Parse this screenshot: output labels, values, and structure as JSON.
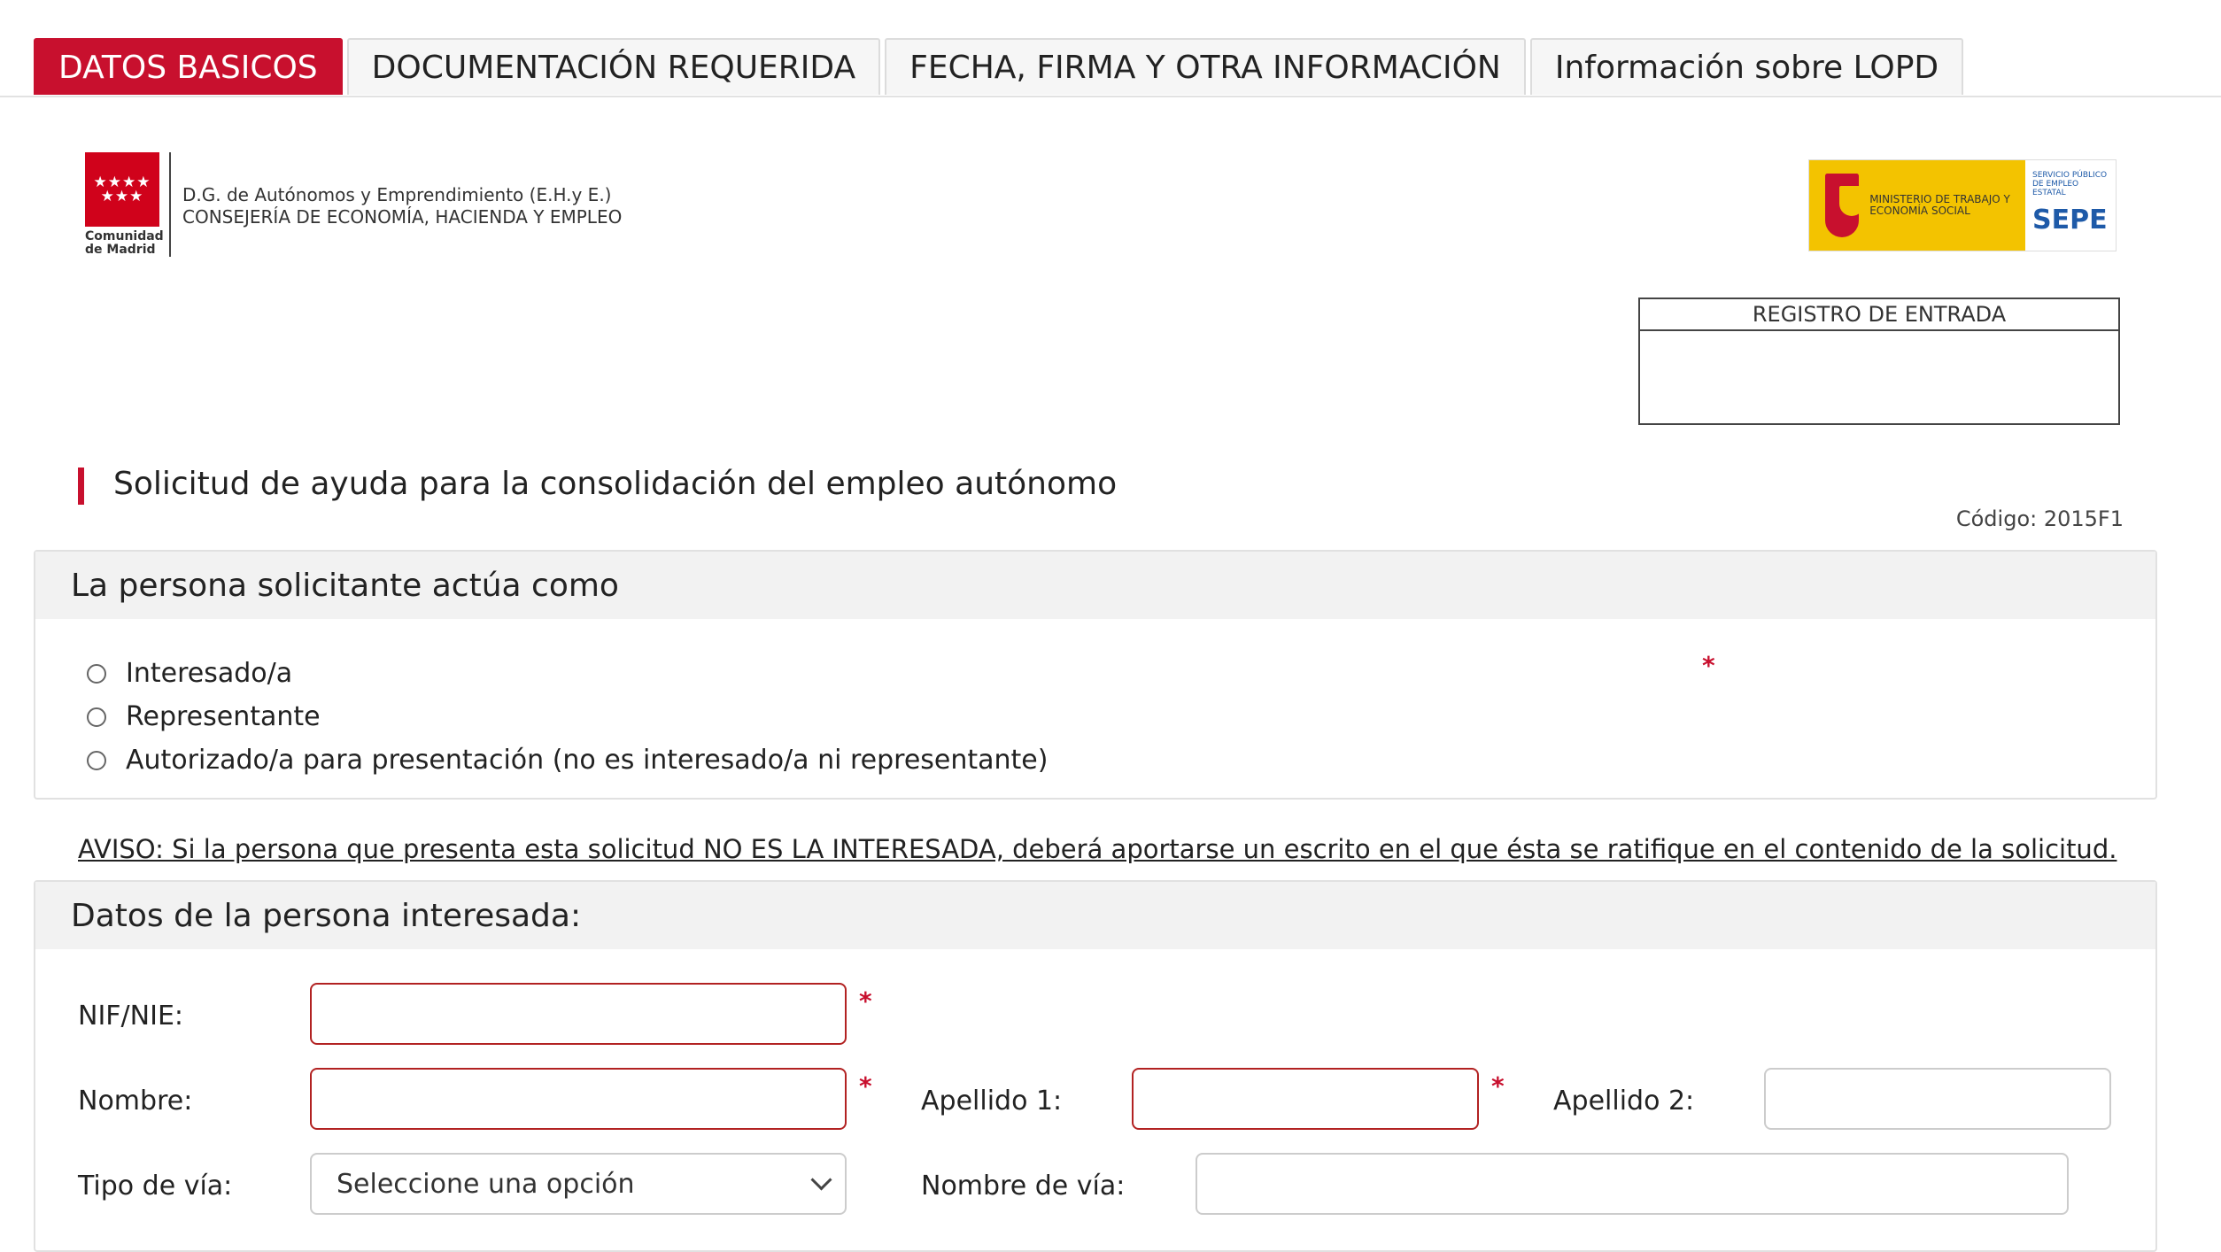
{
  "tabs": [
    {
      "label": "DATOS BASICOS",
      "active": true
    },
    {
      "label": "DOCUMENTACIÓN REQUERIDA",
      "active": false
    },
    {
      "label": "FECHA, FIRMA Y OTRA INFORMACIÓN",
      "active": false
    },
    {
      "label": "Información sobre LOPD",
      "active": false
    }
  ],
  "header": {
    "logo_text": "Comunidad de Madrid",
    "org_line1": "D.G. de Autónomos y Emprendimiento (E.H.y E.)",
    "org_line2": "CONSEJERÍA DE ECONOMÍA, HACIENDA Y EMPLEO",
    "ministry_text": "MINISTERIO DE TRABAJO Y ECONOMÍA SOCIAL",
    "sepe_small": "SERVICIO PÚBLICO DE EMPLEO ESTATAL",
    "sepe_brand": "SEPE",
    "registro_label": "REGISTRO DE ENTRADA"
  },
  "form": {
    "title": "Solicitud de ayuda para la consolidación del empleo autónomo",
    "code": "Código: 2015F1"
  },
  "section1": {
    "heading": "La persona solicitante actúa como",
    "options": [
      "Interesado/a",
      "Representante",
      "Autorizado/a para presentación (no es interesado/a ni representante)"
    ],
    "required_mark": "*"
  },
  "aviso": "AVISO: Si la persona que presenta esta solicitud NO ES LA INTERESADA, deberá aportarse un escrito en el que ésta se ratifique en el contenido de la solicitud.",
  "section2": {
    "heading": "Datos de la persona interesada:",
    "labels": {
      "nif": "NIF/NIE:",
      "nombre": "Nombre:",
      "apellido1": "Apellido 1:",
      "apellido2": "Apellido 2:",
      "tipo_via": "Tipo de vía:",
      "nombre_via": "Nombre de vía:"
    },
    "values": {
      "nif": "",
      "nombre": "",
      "apellido1": "",
      "apellido2": "",
      "nombre_via": ""
    },
    "tipo_via_selected": "Seleccione una opción",
    "required_mark": "*"
  },
  "colors": {
    "accent": "#c8102e",
    "panel_head": "#f2f2f2",
    "sepe_yellow": "#f3c300",
    "sepe_blue": "#1e5aa8"
  }
}
